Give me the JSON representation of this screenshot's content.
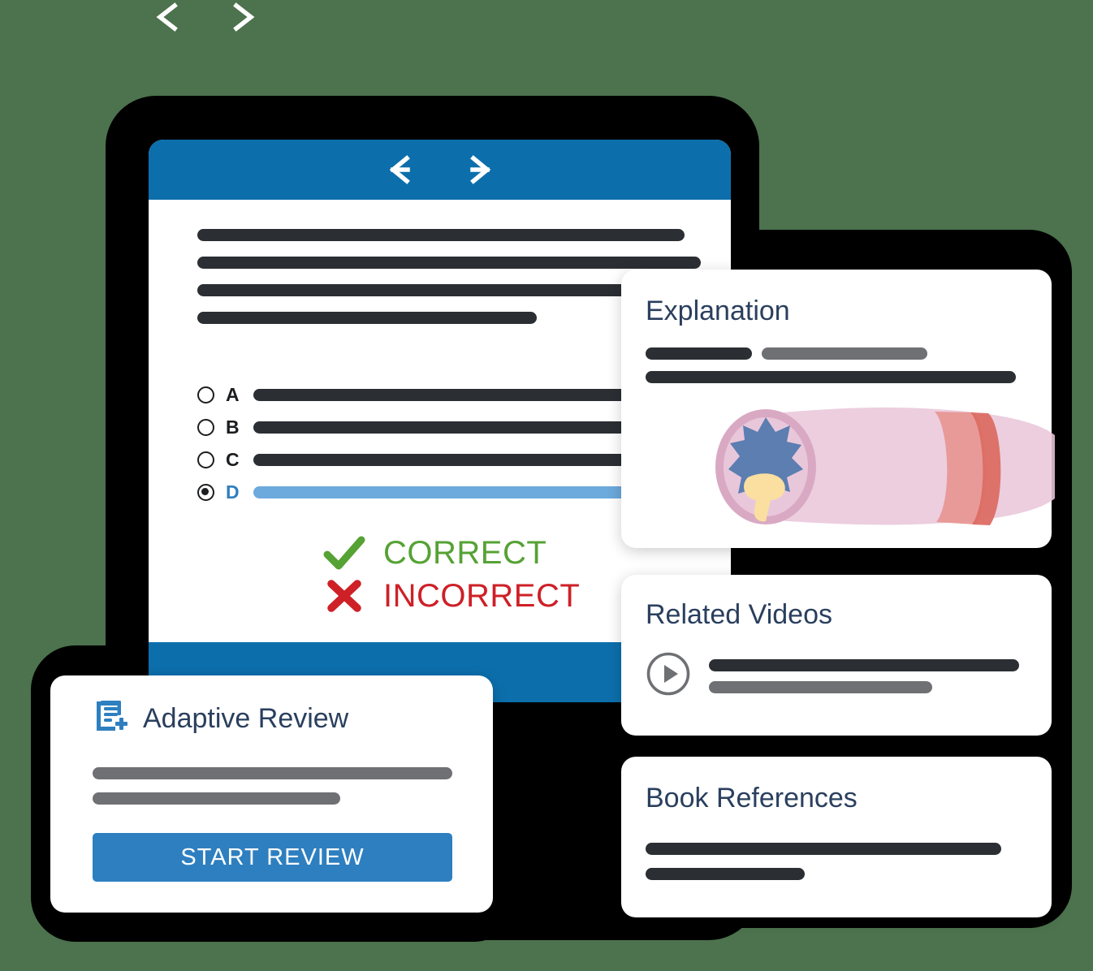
{
  "theme": {
    "background_green": "#4C724E",
    "device_black": "#000000",
    "header_blue": "#0C6FAC",
    "accent_blue": "#2E7FC0",
    "selected_bar_blue": "#6CA9DC",
    "title_navy": "#2A3F5E",
    "bar_dark": "#2B2F33",
    "bar_gray": "#6E7073",
    "correct_green": "#56A234",
    "incorrect_red": "#CE2027"
  },
  "top_nav": {
    "back_icon": "arrow-left-icon",
    "forward_icon": "arrow-right-icon"
  },
  "tablet": {
    "header": {
      "back_icon": "arrow-left-icon",
      "forward_icon": "arrow-right-icon"
    },
    "question": {
      "placeholder_line_count": 4
    },
    "options": [
      {
        "letter": "A",
        "selected": false
      },
      {
        "letter": "B",
        "selected": false
      },
      {
        "letter": "C",
        "selected": false
      },
      {
        "letter": "D",
        "selected": true
      }
    ],
    "verdicts": [
      {
        "label": "CORRECT",
        "icon": "check-icon",
        "state": "correct"
      },
      {
        "label": "INCORRECT",
        "icon": "cross-icon",
        "state": "incorrect"
      }
    ]
  },
  "cards": {
    "explanation": {
      "title": "Explanation",
      "illustration": "blood-vessel-cross-section-illustration",
      "placeholder_line_count": 3
    },
    "related_videos": {
      "title": "Related Videos",
      "play_icon": "play-circle-icon",
      "placeholder_line_count": 2
    },
    "book_references": {
      "title": "Book References",
      "placeholder_line_count": 2
    },
    "adaptive_review": {
      "title": "Adaptive Review",
      "icon": "document-add-icon",
      "placeholder_line_count": 2,
      "button_label": "START REVIEW"
    }
  }
}
